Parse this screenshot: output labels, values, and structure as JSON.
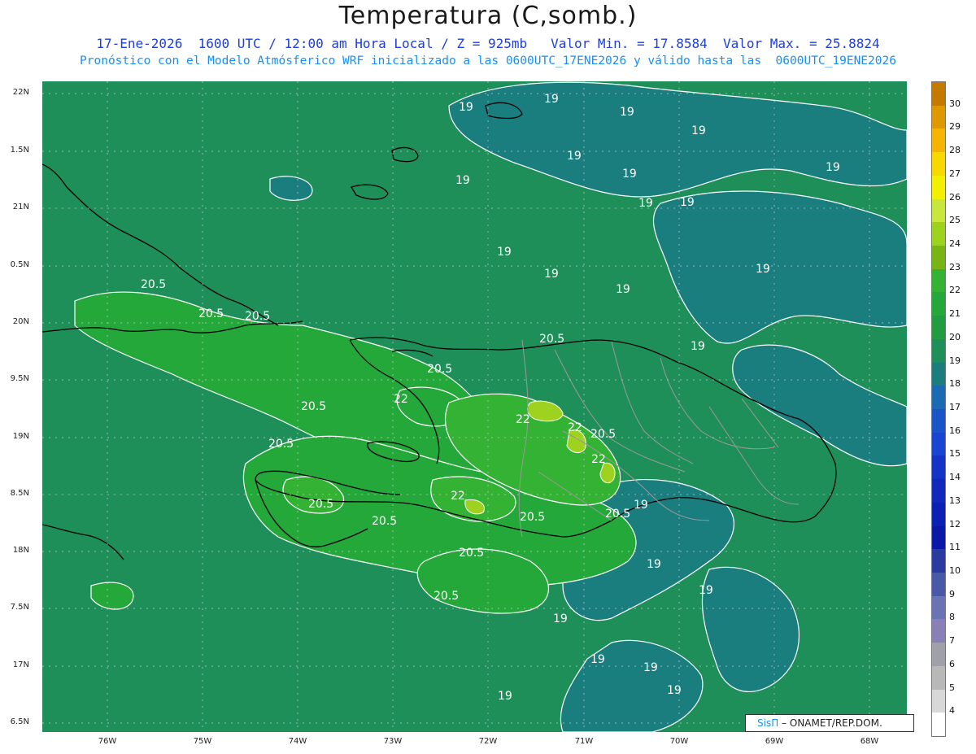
{
  "header": {
    "title": "Temperatura (C,somb.)",
    "line1": "17-Ene-2026  1600 UTC / 12:00 am Hora Local / Z = 925mb   Valor Min. = 17.8584  Valor Max. = 25.8824",
    "line2": "Pronóstico con el Modelo Atmósferico WRF inicializado a las 0600UTC_17ENE2026 y válido hasta las  0600UTC_19ENE2026"
  },
  "axes": {
    "lat_labels": [
      "22N",
      "1.5N",
      "21N",
      "0.5N",
      "20N",
      "9.5N",
      "19N",
      "8.5N",
      "18N",
      "7.5N",
      "17N",
      "6.5N"
    ],
    "lon_labels": [
      "76W",
      "75W",
      "74W",
      "73W",
      "72W",
      "71W",
      "70W",
      "69W",
      "68W"
    ]
  },
  "colorbar": {
    "labels": [
      "30",
      "29",
      "28",
      "27",
      "26",
      "25",
      "24",
      "23",
      "22",
      "21",
      "20",
      "19",
      "18",
      "17",
      "16",
      "15",
      "14",
      "13",
      "12",
      "11",
      "10",
      "9",
      "8",
      "7",
      "6",
      "5",
      "4"
    ],
    "colors": [
      "#c47a00",
      "#e09800",
      "#f5b400",
      "#f7d800",
      "#f0f000",
      "#c8e63c",
      "#9ed21e",
      "#78b414",
      "#33b233",
      "#25a83a",
      "#229c40",
      "#1f8f5a",
      "#1a7e7e",
      "#1a6ab4",
      "#1a55c8",
      "#1a44d2",
      "#1434c8",
      "#1028bc",
      "#0c20b4",
      "#0a18a8",
      "#2a3aa0",
      "#4a58a8",
      "#6a74b4",
      "#8a80b8",
      "#a0a0a8",
      "#b8b8b8",
      "#d8d8d8",
      "#ffffff"
    ]
  },
  "contour_labels": [
    "19",
    "19",
    "19",
    "19",
    "19",
    "19",
    "19",
    "19",
    "19",
    "19",
    "19",
    "19",
    "19",
    "19",
    "19",
    "19",
    "19",
    "19",
    "19",
    "19",
    "19",
    "19",
    "19",
    "20.5",
    "20.5",
    "20.5",
    "20.5",
    "20.5",
    "20.5",
    "20.5",
    "20.5",
    "20.5",
    "20.5",
    "20.5",
    "20.5",
    "20.5",
    "20.5",
    "22",
    "22",
    "22",
    "22",
    "22"
  ],
  "credit": {
    "logo": "SisΠ",
    "text": "– ONAMET/REP.DOM."
  },
  "colors": {
    "base": "#1f8f5a",
    "cool": "#1a7e7e",
    "warm": "#25a83a",
    "hot": "#33b233",
    "hottest": "#9ed21e",
    "coast": "#000000",
    "border": "#999999",
    "contour": "#ffffff",
    "title": "#1a1a1a",
    "subtitle1": "#1f3fd6",
    "subtitle2": "#1a8ff0"
  }
}
